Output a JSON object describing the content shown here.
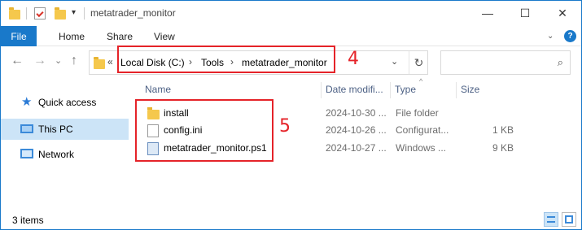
{
  "window": {
    "title": "metatrader_monitor",
    "controls": {
      "minimize": "—",
      "maximize": "☐",
      "close": "✕"
    }
  },
  "ribbon": {
    "tabs": [
      "File",
      "Home",
      "Share",
      "View"
    ],
    "expand_glyph": "⌄",
    "help": "?"
  },
  "nav": {
    "back": "←",
    "forward": "→",
    "recent": "⌄",
    "up": "↑",
    "overflow": "«",
    "breadcrumbs": [
      "Local Disk (C:)",
      "Tools",
      "metatrader_monitor"
    ],
    "crumb_sep": "›",
    "dropdown": "⌄",
    "refresh": "↻",
    "search_placeholder": "",
    "search_glyph": "⌕"
  },
  "annotations": {
    "address_label": "4",
    "files_label": "5",
    "color": "#e52329"
  },
  "sidebar": {
    "items": [
      {
        "label": "Quick access",
        "icon": "star-icon",
        "active": false
      },
      {
        "label": "This PC",
        "icon": "pc-icon",
        "active": true
      },
      {
        "label": "Network",
        "icon": "network-icon",
        "active": false
      }
    ]
  },
  "list": {
    "columns": {
      "name": "Name",
      "date": "Date modifi...",
      "type": "Type",
      "size": "Size"
    },
    "sort_indicator": "^",
    "rows": [
      {
        "name": "install",
        "date": "2024-10-30 ...",
        "type": "File folder",
        "size": "",
        "icon": "folder-icon"
      },
      {
        "name": "config.ini",
        "date": "2024-10-26 ...",
        "type": "Configurat...",
        "size": "1 KB",
        "icon": "ini-file-icon"
      },
      {
        "name": "metatrader_monitor.ps1",
        "date": "2024-10-27 ...",
        "type": "Windows ...",
        "size": "9 KB",
        "icon": "powershell-file-icon"
      }
    ]
  },
  "status": {
    "items_count": "3 items"
  },
  "colors": {
    "accent": "#1979ca",
    "selection": "#cce4f7",
    "header_text": "#4d6185"
  }
}
